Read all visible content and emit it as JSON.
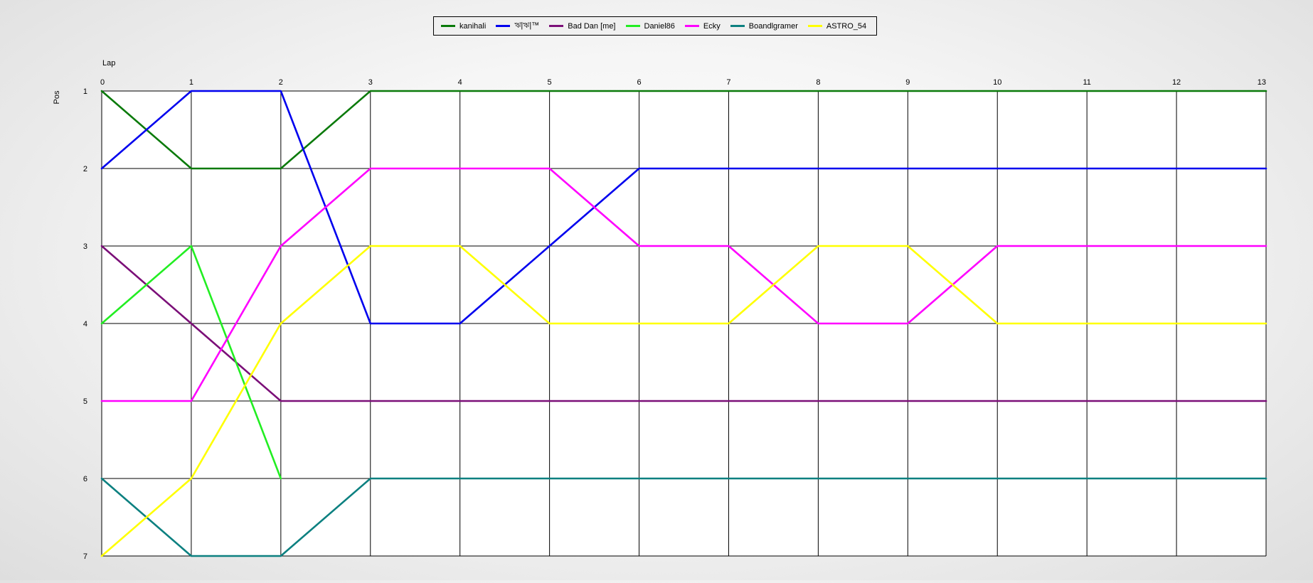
{
  "chart_data": {
    "type": "line",
    "xlabel": "Lap",
    "ylabel": "Pos",
    "x": [
      0,
      1,
      2,
      3,
      4,
      5,
      6,
      7,
      8,
      9,
      10,
      11,
      12,
      13
    ],
    "xlim": [
      0,
      13
    ],
    "ylim": [
      1,
      7
    ],
    "y_inverted": true,
    "yticks": [
      1,
      2,
      3,
      4,
      5,
      6,
      7
    ],
    "grid": true,
    "legend_position": "top-center",
    "series": [
      {
        "name": "kanihali",
        "color": "#0a7a0a",
        "values": [
          1,
          2,
          2,
          1,
          1,
          1,
          1,
          1,
          1,
          1,
          1,
          1,
          1,
          1
        ]
      },
      {
        "name": "ঋ|ঋ|™",
        "color": "#0000ee",
        "values": [
          2,
          1,
          1,
          4,
          4,
          3,
          2,
          2,
          2,
          2,
          2,
          2,
          2,
          2
        ]
      },
      {
        "name": "Bad Dan [me]",
        "color": "#7b0f78",
        "values": [
          3,
          4,
          5,
          5,
          5,
          5,
          5,
          5,
          5,
          5,
          5,
          5,
          5,
          5
        ]
      },
      {
        "name": "Daniel86",
        "color": "#22ee22",
        "values": [
          4,
          3,
          6,
          null,
          null,
          null,
          null,
          null,
          null,
          null,
          null,
          null,
          null,
          null
        ]
      },
      {
        "name": "Ecky",
        "color": "#ff00ff",
        "values": [
          5,
          5,
          3,
          2,
          2,
          2,
          3,
          3,
          4,
          4,
          3,
          3,
          3,
          3
        ]
      },
      {
        "name": "Boandlgramer",
        "color": "#0c8080",
        "values": [
          6,
          7,
          7,
          6,
          6,
          6,
          6,
          6,
          6,
          6,
          6,
          6,
          6,
          6
        ]
      },
      {
        "name": "ASTRO_54",
        "color": "#ffff00",
        "values": [
          7,
          6,
          4,
          3,
          3,
          4,
          4,
          4,
          3,
          3,
          4,
          4,
          4,
          4
        ]
      }
    ]
  }
}
